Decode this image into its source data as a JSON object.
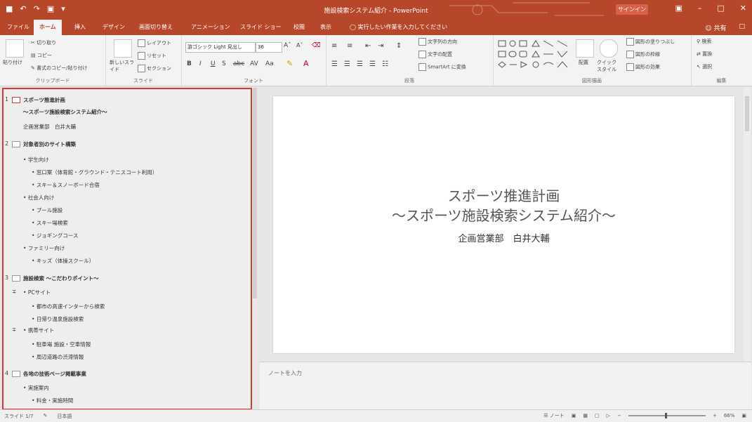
{
  "titlebar": {
    "title": "施設検索システム紹介 - PowerPoint",
    "signin": "サインイン",
    "qat_icons": [
      "save-icon",
      "undo-icon",
      "redo-icon",
      "start-slideshow-icon"
    ]
  },
  "tabs": [
    "ファイル",
    "ホーム",
    "挿入",
    "デザイン",
    "画面切り替え",
    "アニメーション",
    "スライド ショー",
    "校閲",
    "表示"
  ],
  "active_tab": "ホーム",
  "tell_me": "実行したい作業を入力してください",
  "share": "共有",
  "ribbon": {
    "clipboard": {
      "paste": "貼り付け",
      "cut": "切り取り",
      "copy": "コピー",
      "format": "書式のコピー/貼り付け",
      "label": "クリップボード"
    },
    "slides": {
      "new": "新しいスライド",
      "layout": "レイアウト",
      "reset": "リセット",
      "section": "セクション",
      "label": "スライド"
    },
    "font": {
      "name": "游ゴシック Light 見出し",
      "size": "36",
      "label": "フォント"
    },
    "paragraph": {
      "dir": "文字列の方向",
      "align": "文字の配置",
      "smartart": "SmartArt に変換",
      "label": "段落"
    },
    "drawing": {
      "arrange": "配置",
      "quick": "クイック スタイル",
      "fill": "図形の塗りつぶし",
      "outline": "図形の枠線",
      "effect": "図形の効果",
      "label": "図形描画"
    },
    "editing": {
      "find": "検索",
      "replace": "置換",
      "select": "選択",
      "label": "編集"
    }
  },
  "outline": [
    {
      "num": "1",
      "text": "スポーツ推進計画",
      "level": 0,
      "bold": true
    },
    {
      "text": "～スポーツ施設検索システム紹介～",
      "level": 0,
      "bold": true
    },
    {
      "text": "企画営業部　白井大輔",
      "level": 0,
      "bold": false
    },
    {
      "num": "2",
      "text": "対象者別のサイト構築",
      "level": 0,
      "bold": true
    },
    {
      "text": "学生向け",
      "level": 1
    },
    {
      "text": "窓口案（体育館・グラウンド・テニスコート利用）",
      "level": 2
    },
    {
      "text": "スキー＆スノーボード合宿",
      "level": 2
    },
    {
      "text": "社会人向け",
      "level": 1
    },
    {
      "text": "プール施設",
      "level": 2
    },
    {
      "text": "スキー場検索",
      "level": 2
    },
    {
      "text": "ジョギングコース",
      "level": 2
    },
    {
      "text": "ファミリー向け",
      "level": 1
    },
    {
      "text": "キッズ（体操スクール）",
      "level": 2
    },
    {
      "num": "3",
      "text": "施設検索 ～こだわりポイント～",
      "level": 0,
      "bold": true
    },
    {
      "text": "PCサイト",
      "level": 1
    },
    {
      "text": "都市の高速インターから検索",
      "level": 2
    },
    {
      "text": "日帰り温泉施設検索",
      "level": 2
    },
    {
      "text": "携帯サイト",
      "level": 1
    },
    {
      "text": "駐車場 施設・空車情報",
      "level": 2
    },
    {
      "text": "周辺道路の渋滞情報",
      "level": 2
    },
    {
      "num": "4",
      "text": "各地の技術ページ掲載事業",
      "level": 0,
      "bold": true
    },
    {
      "text": "実施案内",
      "level": 1
    },
    {
      "text": "料金・実施時間",
      "level": 2
    }
  ],
  "slide": {
    "title1": "スポーツ推進計画",
    "title2": "～スポーツ施設検索システム紹介～",
    "subtitle": "企画営業部　白井大輔"
  },
  "notes_placeholder": "ノートを入力",
  "status": {
    "slide": "スライド 1/7",
    "lang": "日本語",
    "notes": "ノート",
    "zoom": "66%"
  },
  "colors": {
    "accent": "#b7472a",
    "outline_border": "#e0343b"
  }
}
